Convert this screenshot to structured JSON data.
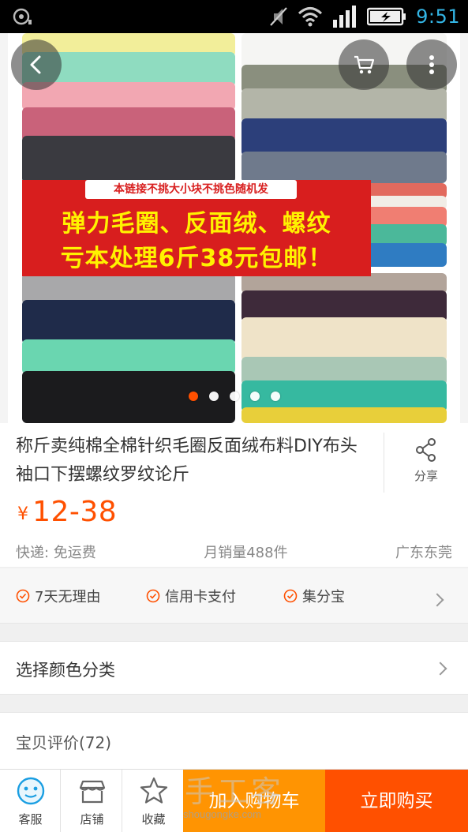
{
  "status_bar": {
    "time": "9:51"
  },
  "hero": {
    "banner_tag": "本链接不挑大小块不挑色随机发",
    "banner_line1": "弹力毛圈、反面绒、螺纹",
    "banner_line2": "亏本处理6斤38元包邮！",
    "dots_total": 5,
    "dots_active": 1
  },
  "product": {
    "title": "称斤卖纯棉全棉针织毛圈反面绒布料DIY布头袖口下摆螺纹罗纹论斤",
    "share_label": "分享",
    "price_symbol": "¥",
    "price": "12-38",
    "shipping": "快递: 免运费",
    "monthly_sales": "月销量488件",
    "location": "广东东莞"
  },
  "guarantees": [
    "7天无理由",
    "信用卡支付",
    "集分宝"
  ],
  "sku_select": {
    "label": "选择颜色分类"
  },
  "reviews": {
    "label": "宝贝评价(72)"
  },
  "bottom_bar": {
    "service": "客服",
    "shop": "店铺",
    "favorite": "收藏",
    "add_to_cart": "加入购物车",
    "buy_now": "立即购买"
  },
  "watermark": {
    "big": "手工客",
    "small": "shougongke.com"
  },
  "colors": {
    "accent": "#ff5000",
    "cart": "#ff9402",
    "status_time": "#33b5e5",
    "banner": "#d81e1e",
    "banner_text": "#fff200"
  }
}
